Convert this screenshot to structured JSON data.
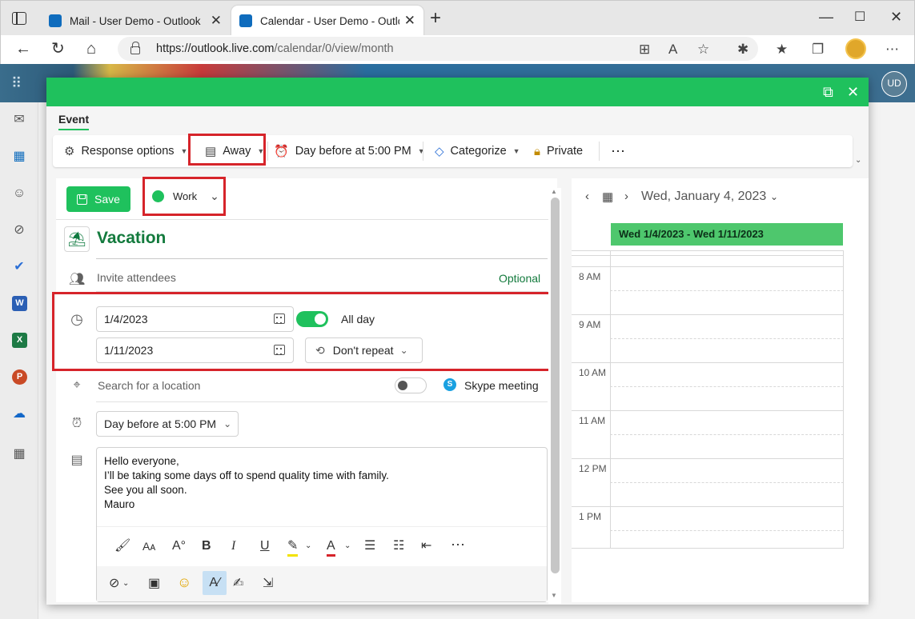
{
  "browser": {
    "tabs": [
      {
        "title": "Mail - User Demo - Outlook",
        "active": false
      },
      {
        "title": "Calendar - User Demo - Outlook",
        "active": true
      }
    ],
    "url_host": "https://outlook.live.com",
    "url_path": "/calendar/0/view/month"
  },
  "outlook": {
    "avatar_initials": "UD"
  },
  "modal": {
    "tab_label": "Event",
    "ribbon": {
      "response_options": "Response options",
      "show_as": "Away",
      "reminder": "Day before at 5:00 PM",
      "categorize": "Categorize",
      "private": "Private",
      "more": "⋯"
    },
    "form": {
      "save_label": "Save",
      "category": "Work",
      "title": "Vacation",
      "attendees_placeholder": "Invite attendees",
      "optional_label": "Optional",
      "start_date": "1/4/2023",
      "end_date": "1/11/2023",
      "all_day_label": "All day",
      "all_day": true,
      "repeat": "Don't repeat",
      "location_placeholder": "Search for a location",
      "skype_label": "Skype meeting",
      "skype_on": false,
      "reminder": "Day before at 5:00 PM",
      "body_lines": [
        "Hello everyone,",
        "I’ll be taking some days off to spend quality time with family.",
        "See you all soon.",
        "Mauro"
      ]
    },
    "calendar": {
      "date_heading": "Wed, January 4, 2023",
      "event_label": "Wed 1/4/2023 - Wed 1/11/2023",
      "hours": [
        "8 AM",
        "9 AM",
        "10 AM",
        "11 AM",
        "12 PM",
        "1 PM"
      ]
    }
  },
  "colors": {
    "accent": "#1fc15d",
    "highlight": "#d6242a",
    "title_green": "#137a3d"
  }
}
